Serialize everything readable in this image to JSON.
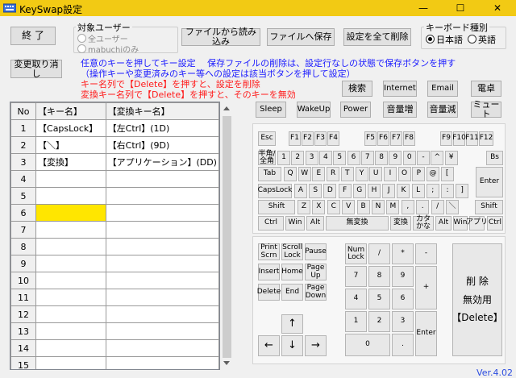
{
  "window": {
    "title": "KeySwap設定",
    "controls": {
      "minimize": "—",
      "maximize": "☐",
      "close": "✕"
    },
    "accent": "#f2ca14"
  },
  "toolbar": {
    "exit": "終 了",
    "undo": "変更取り消し",
    "load_file": "ファイルから読み込み",
    "save_file": "ファイルへ保存",
    "delete_all": "設定を全て削除"
  },
  "target_user": {
    "legend": "対象ユーザー",
    "all_users": "全ユーザー",
    "mabuchi_only": "mabuchiのみ"
  },
  "keyboard_type": {
    "legend": "キーボード種別",
    "japanese": "日本語",
    "english": "英語"
  },
  "info": {
    "line1": "任意のキーを押してキー設定　 保存ファイルの削除は、設定行なしの状態で保存ボタンを押す",
    "line2": "（操作キーや変更済みのキー等への設定は該当ボタンを押して設定）",
    "line3": "キー名列で【Delete】を押すと、設定を削除",
    "line4": "変換キー名列で【Delete】を押すと、そのキーを無効"
  },
  "special_keys": {
    "search": "検索",
    "internet": "Internet",
    "email": "Email",
    "phone": "電卓",
    "sleep": "Sleep",
    "wakeup": "WakeUp",
    "power": "Power",
    "vol_up": "音量増",
    "vol_down": "音量減",
    "mute": "ミュート"
  },
  "table": {
    "headers": [
      "No",
      "【キー名】",
      "【変換キー名】"
    ],
    "rows": [
      {
        "no": "1",
        "key": "【CapsLock】",
        "mapped": "【左Ctrl】(1D)"
      },
      {
        "no": "2",
        "key": "【＼】",
        "mapped": "【右Ctrl】(9D)"
      },
      {
        "no": "3",
        "key": "【変換】",
        "mapped": "【アプリケーション】(DD)"
      },
      {
        "no": "4",
        "key": "",
        "mapped": ""
      },
      {
        "no": "5",
        "key": "",
        "mapped": ""
      },
      {
        "no": "6",
        "key": "",
        "mapped": ""
      },
      {
        "no": "7",
        "key": "",
        "mapped": ""
      },
      {
        "no": "8",
        "key": "",
        "mapped": ""
      },
      {
        "no": "9",
        "key": "",
        "mapped": ""
      },
      {
        "no": "10",
        "key": "",
        "mapped": ""
      },
      {
        "no": "11",
        "key": "",
        "mapped": ""
      },
      {
        "no": "12",
        "key": "",
        "mapped": ""
      },
      {
        "no": "13",
        "key": "",
        "mapped": ""
      },
      {
        "no": "14",
        "key": "",
        "mapped": ""
      },
      {
        "no": "15",
        "key": "",
        "mapped": ""
      }
    ],
    "selected_color": "#ffe600"
  },
  "keyboard": {
    "fn_row": [
      "Esc",
      "F1",
      "F2",
      "F3",
      "F4",
      "F5",
      "F6",
      "F7",
      "F8",
      "F9",
      "F10",
      "F11",
      "F12"
    ],
    "num_row": [
      "半角/\n全角",
      "1",
      "2",
      "3",
      "4",
      "5",
      "6",
      "7",
      "8",
      "9",
      "0",
      "-",
      "^",
      "¥",
      "Bs"
    ],
    "row_q": [
      "Tab",
      "Q",
      "W",
      "E",
      "R",
      "T",
      "Y",
      "U",
      "I",
      "O",
      "P",
      "@",
      "["
    ],
    "enter": "Enter",
    "row_a": [
      "CapsLock",
      "A",
      "S",
      "D",
      "F",
      "G",
      "H",
      "J",
      "K",
      "L",
      ";",
      ":",
      "]"
    ],
    "row_z": [
      "Shift",
      "Z",
      "X",
      "C",
      "V",
      "B",
      "N",
      "M",
      ",",
      ".",
      "/",
      "＼",
      "Shift"
    ],
    "row_bottom": [
      "Ctrl",
      "Win",
      "Alt",
      "無変換",
      "変換",
      "カタ\nかな",
      "Alt",
      "Win",
      "アプリ",
      "Ctrl"
    ],
    "nav": [
      "Print\nScrn",
      "Scroll\nLock",
      "Pause",
      "Insert",
      "Home",
      "Page\nUp",
      "Delete",
      "End",
      "Page\nDown"
    ],
    "arrows": [
      "↑",
      "←",
      "↓",
      "→"
    ],
    "numpad": {
      "numlock": "Num\nLock",
      "row1": [
        "/",
        "*",
        "-"
      ],
      "row2": [
        "7",
        "8",
        "9"
      ],
      "row3": [
        "4",
        "5",
        "6"
      ],
      "row4": [
        "1",
        "2",
        "3"
      ],
      "plus": "+",
      "enter": "Enter",
      "zero": "0",
      "dot": "."
    },
    "delete_disable": {
      "l1": "削 除",
      "l2": "無効用",
      "l3": "【Delete】"
    }
  },
  "version": "Ver.4.02"
}
